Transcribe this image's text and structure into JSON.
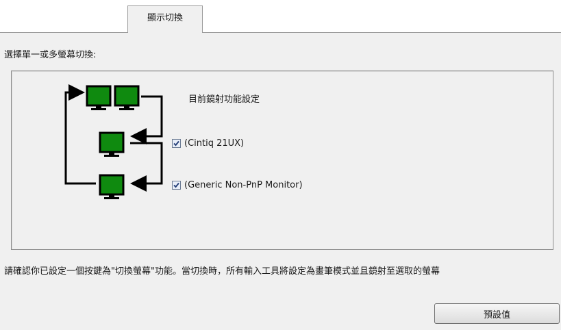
{
  "tab": {
    "label": "顯示切換"
  },
  "prompt": "選擇單一或多螢幕切換:",
  "current": {
    "label": "目前鏡射功能設定"
  },
  "monitors": [
    {
      "label": "(Cintiq 21UX)",
      "checked": true
    },
    {
      "label": "(Generic Non-PnP Monitor)",
      "checked": true
    }
  ],
  "note": "請確認你已設定一個按鍵為\"切換螢幕\"功能。當切換時，所有輸入工具將設定為畫筆模式並且鏡射至選取的螢幕",
  "buttons": {
    "default_label": "預設值"
  },
  "colors": {
    "monitor_green": "#0f8a0f",
    "panel_bg": "#f0f0f0"
  }
}
